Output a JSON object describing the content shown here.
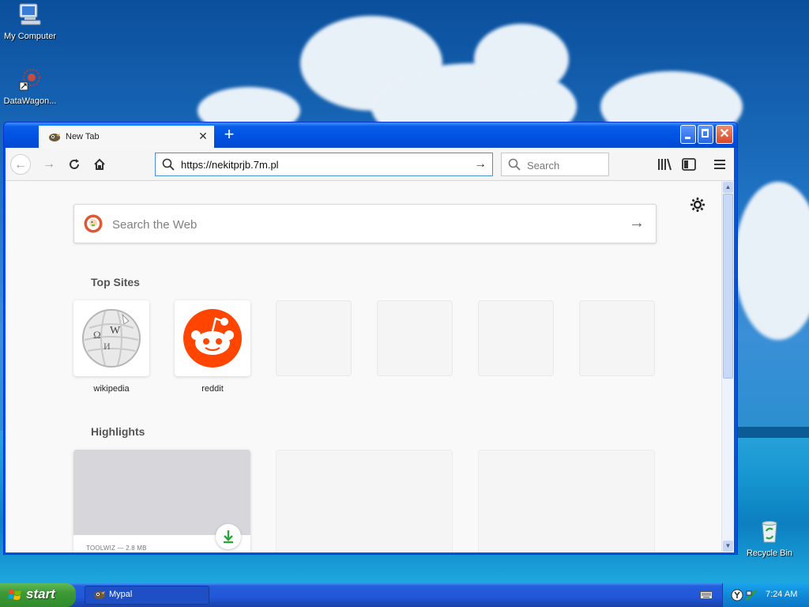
{
  "desktop": {
    "icons": [
      {
        "label": "My Computer"
      },
      {
        "label": "DataWagon..."
      },
      {
        "label": "Recycle Bin"
      }
    ]
  },
  "browser": {
    "tab": {
      "title": "New Tab",
      "close_icon": "close-icon"
    },
    "url": "https://nekitprjb.7m.pl",
    "search_placeholder": "Search",
    "newtab": {
      "websearch_placeholder": "Search the Web",
      "top_sites_title": "Top Sites",
      "top_sites": [
        {
          "label": "wikipedia",
          "icon": "wikipedia-globe"
        },
        {
          "label": "reddit",
          "icon": "reddit-alien"
        }
      ],
      "highlights_title": "Highlights",
      "highlight": {
        "meta": "TOOLWIZ — 2.8 MB"
      }
    }
  },
  "taskbar": {
    "start_label": "start",
    "task_label": "Mypal",
    "clock": "7:24 AM"
  },
  "colors": {
    "reddit": "#ff4500",
    "firefox_accent": "#0a84ff",
    "xp_blue": "#0054e3",
    "start_green": "#3c9a35"
  }
}
